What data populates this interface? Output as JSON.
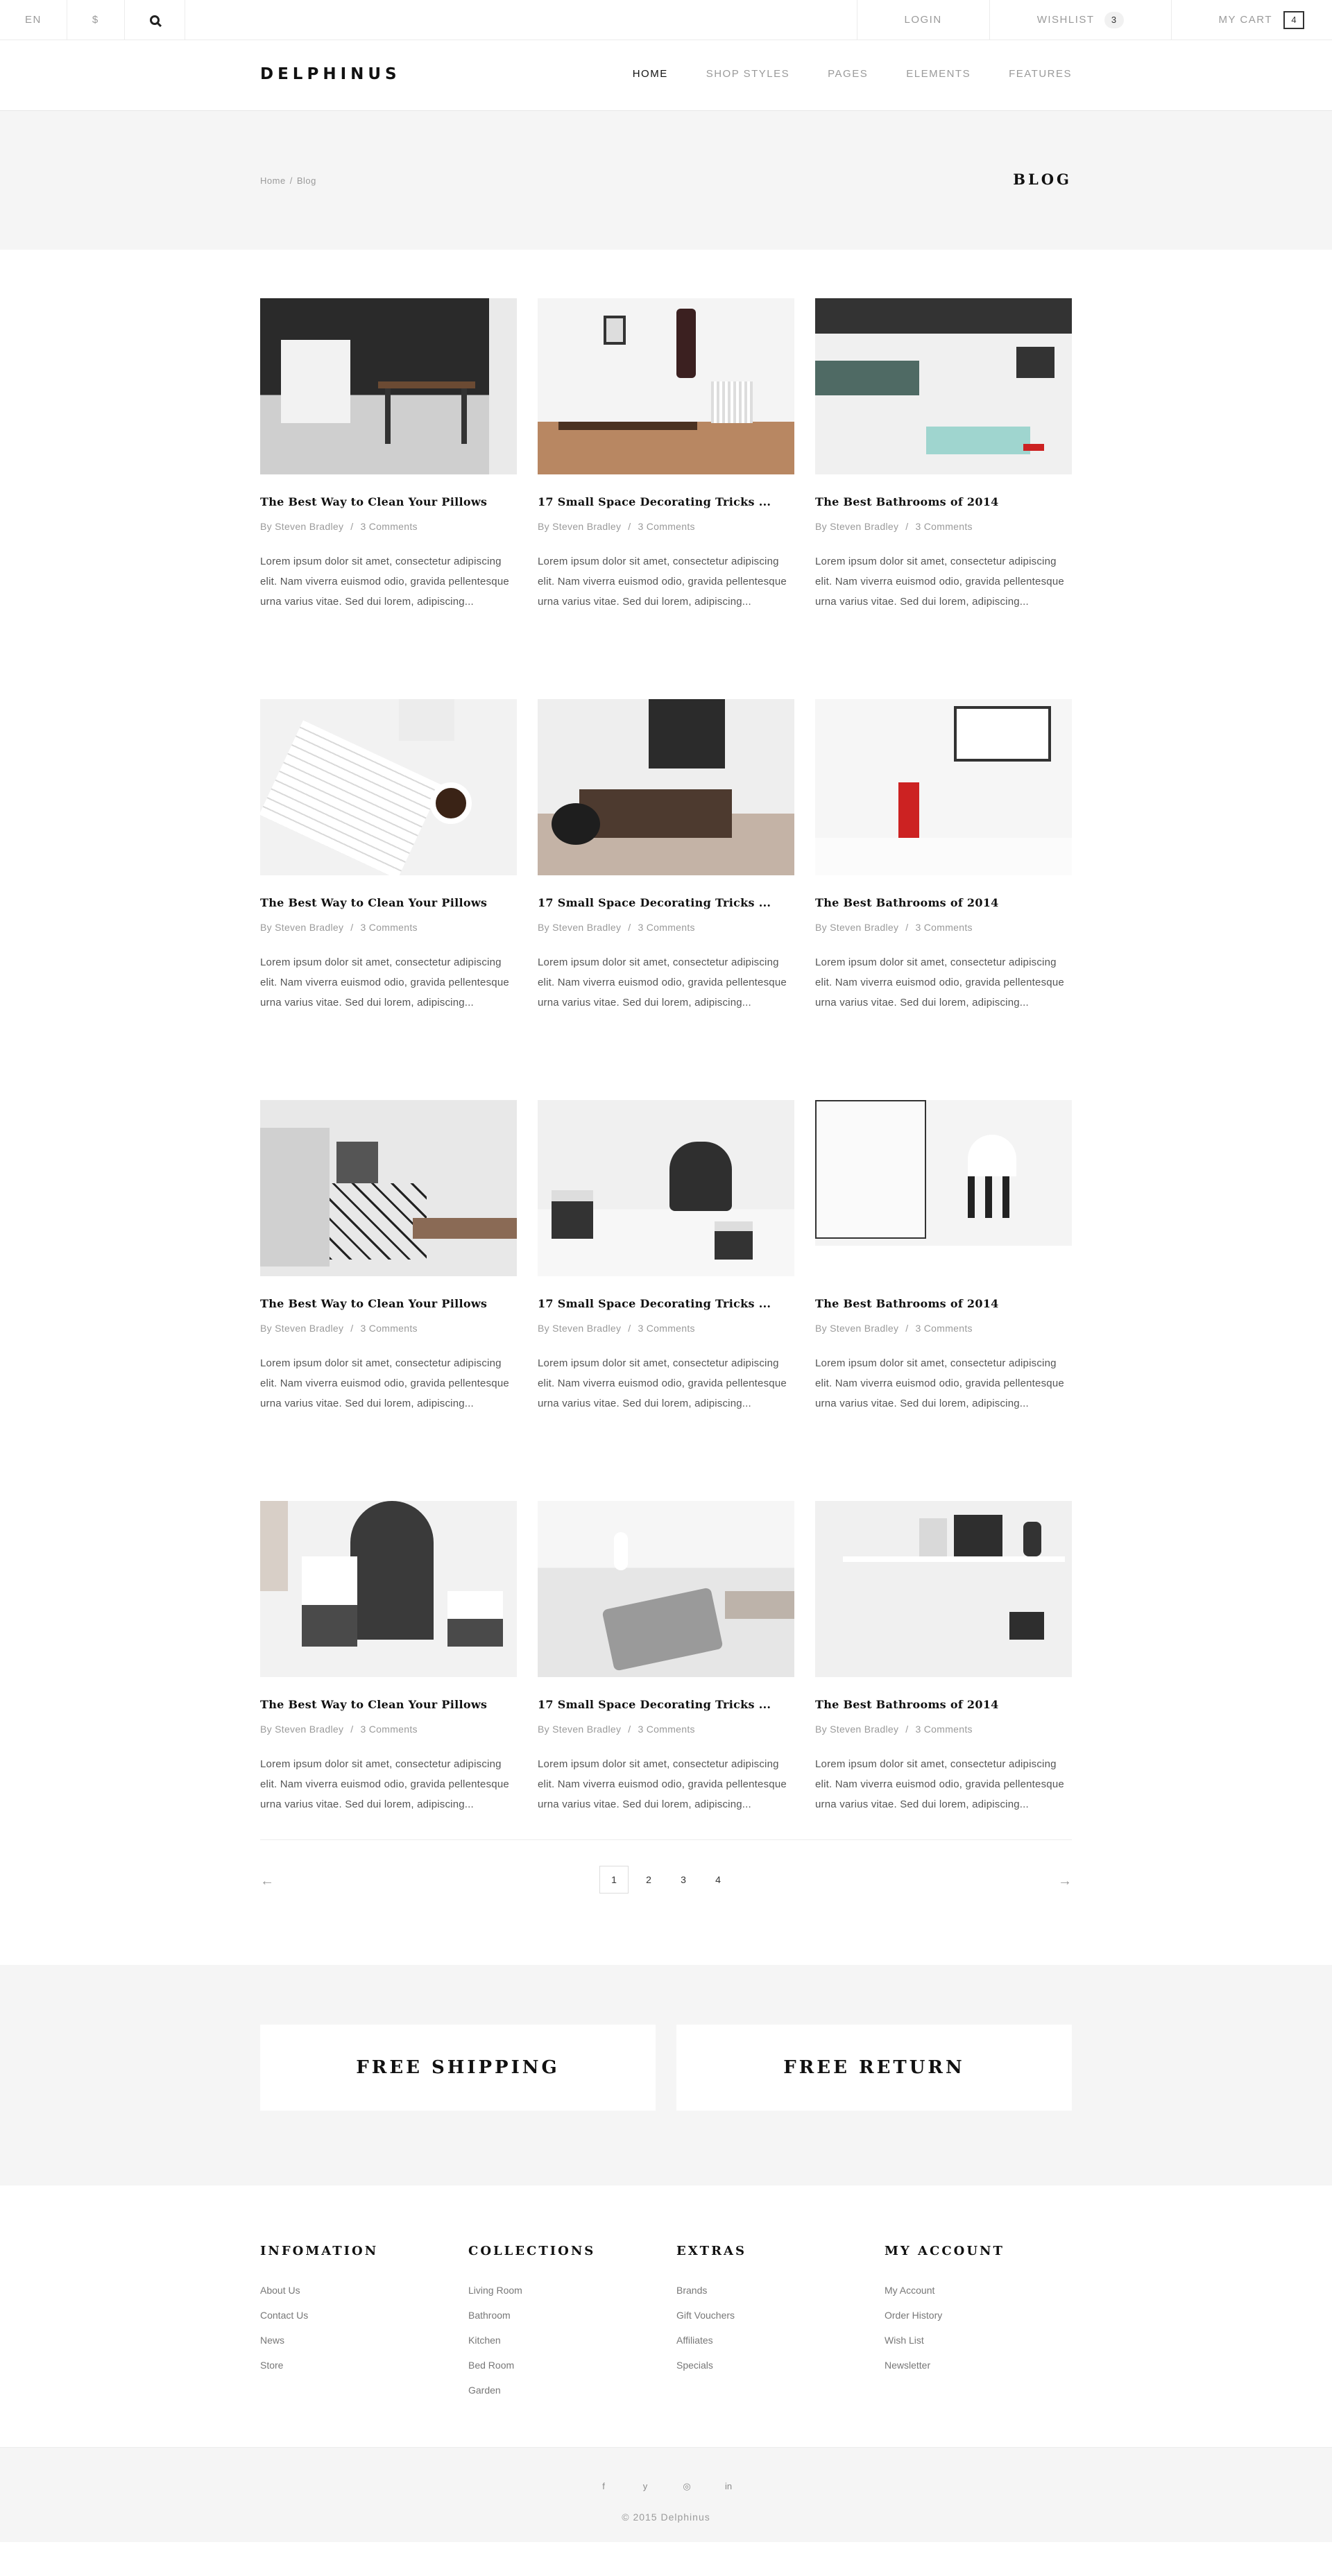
{
  "topbar": {
    "language": "EN",
    "currency": "$",
    "login": "LOGIN",
    "wishlist_label": "WISHLIST",
    "wishlist_count": "3",
    "cart_label": "MY CART",
    "cart_count": "4"
  },
  "header": {
    "logo": "DELPHINUS",
    "nav": [
      "HOME",
      "SHOP STYLES",
      "PAGES",
      "ELEMENTS",
      "FEATURES"
    ],
    "active_nav": "HOME"
  },
  "titleband": {
    "breadcrumb": [
      "Home",
      "/",
      "Blog"
    ],
    "title": "BLOG"
  },
  "posts": [
    {
      "title": "The Best Way to Clean Your Pillows",
      "author": "By Steven Bradley",
      "comments": "3 Comments",
      "excerpt": "Lorem ipsum dolor sit amet, consectetur adipiscing elit. Nam viverra euismod odio, gravida pellentesque urna varius vitae. Sed dui lorem, adipiscing..."
    },
    {
      "title": "17 Small Space Decorating Tricks ...",
      "author": "By Steven Bradley",
      "comments": "3 Comments",
      "excerpt": "Lorem ipsum dolor sit amet, consectetur adipiscing elit. Nam viverra euismod odio, gravida pellentesque urna varius vitae. Sed dui lorem, adipiscing..."
    },
    {
      "title": "The Best Bathrooms of 2014",
      "author": "By Steven Bradley",
      "comments": "3 Comments",
      "excerpt": "Lorem ipsum dolor sit amet, consectetur adipiscing elit. Nam viverra euismod odio, gravida pellentesque urna varius vitae. Sed dui lorem, adipiscing..."
    },
    {
      "title": "The Best Way to Clean Your Pillows",
      "author": "By Steven Bradley",
      "comments": "3 Comments",
      "excerpt": "Lorem ipsum dolor sit amet, consectetur adipiscing elit. Nam viverra euismod odio, gravida pellentesque urna varius vitae. Sed dui lorem, adipiscing..."
    },
    {
      "title": "17 Small Space Decorating Tricks ...",
      "author": "By Steven Bradley",
      "comments": "3 Comments",
      "excerpt": "Lorem ipsum dolor sit amet, consectetur adipiscing elit. Nam viverra euismod odio, gravida pellentesque urna varius vitae. Sed dui lorem, adipiscing..."
    },
    {
      "title": "The Best Bathrooms of 2014",
      "author": "By Steven Bradley",
      "comments": "3 Comments",
      "excerpt": "Lorem ipsum dolor sit amet, consectetur adipiscing elit. Nam viverra euismod odio, gravida pellentesque urna varius vitae. Sed dui lorem, adipiscing..."
    },
    {
      "title": "The Best Way to Clean Your Pillows",
      "author": "By Steven Bradley",
      "comments": "3 Comments",
      "excerpt": "Lorem ipsum dolor sit amet, consectetur adipiscing elit. Nam viverra euismod odio, gravida pellentesque urna varius vitae. Sed dui lorem, adipiscing..."
    },
    {
      "title": "17 Small Space Decorating Tricks ...",
      "author": "By Steven Bradley",
      "comments": "3 Comments",
      "excerpt": "Lorem ipsum dolor sit amet, consectetur adipiscing elit. Nam viverra euismod odio, gravida pellentesque urna varius vitae. Sed dui lorem, adipiscing..."
    },
    {
      "title": "The Best Bathrooms of 2014",
      "author": "By Steven Bradley",
      "comments": "3 Comments",
      "excerpt": "Lorem ipsum dolor sit amet, consectetur adipiscing elit. Nam viverra euismod odio, gravida pellentesque urna varius vitae. Sed dui lorem, adipiscing..."
    },
    {
      "title": "The Best Way to Clean Your Pillows",
      "author": "By Steven Bradley",
      "comments": "3 Comments",
      "excerpt": "Lorem ipsum dolor sit amet, consectetur adipiscing elit. Nam viverra euismod odio, gravida pellentesque urna varius vitae. Sed dui lorem, adipiscing..."
    },
    {
      "title": "17 Small Space Decorating Tricks ...",
      "author": "By Steven Bradley",
      "comments": "3 Comments",
      "excerpt": "Lorem ipsum dolor sit amet, consectetur adipiscing elit. Nam viverra euismod odio, gravida pellentesque urna varius vitae. Sed dui lorem, adipiscing..."
    },
    {
      "title": "The Best Bathrooms of 2014",
      "author": "By Steven Bradley",
      "comments": "3 Comments",
      "excerpt": "Lorem ipsum dolor sit amet, consectetur adipiscing elit. Nam viverra euismod odio, gravida pellentesque urna varius vitae. Sed dui lorem, adipiscing..."
    }
  ],
  "pagination": {
    "prev": "←",
    "next": "→",
    "pages": [
      "1",
      "2",
      "3",
      "4"
    ],
    "current": "1"
  },
  "features": [
    "FREE SHIPPING",
    "FREE RETURN"
  ],
  "footer": {
    "columns": [
      {
        "heading": "INFOMATION",
        "links": [
          "About Us",
          "Contact Us",
          "News",
          "Store"
        ]
      },
      {
        "heading": "COLLECTIONS",
        "links": [
          "Living Room",
          "Bathroom",
          "Kitchen",
          "Bed Room",
          "Garden"
        ]
      },
      {
        "heading": "EXTRAS",
        "links": [
          "Brands",
          "Gift Vouchers",
          "Affiliates",
          "Specials"
        ]
      },
      {
        "heading": "MY ACCOUNT",
        "links": [
          "My Account",
          "Order History",
          "Wish List",
          "Newsletter"
        ]
      }
    ],
    "socials": [
      {
        "icon": "facebook-icon",
        "glyph": "f"
      },
      {
        "icon": "twitter-icon",
        "glyph": "y"
      },
      {
        "icon": "instagram-icon",
        "glyph": "◎"
      },
      {
        "icon": "linkedin-icon",
        "glyph": "in"
      }
    ],
    "copyright": "© 2015 Delphinus"
  }
}
